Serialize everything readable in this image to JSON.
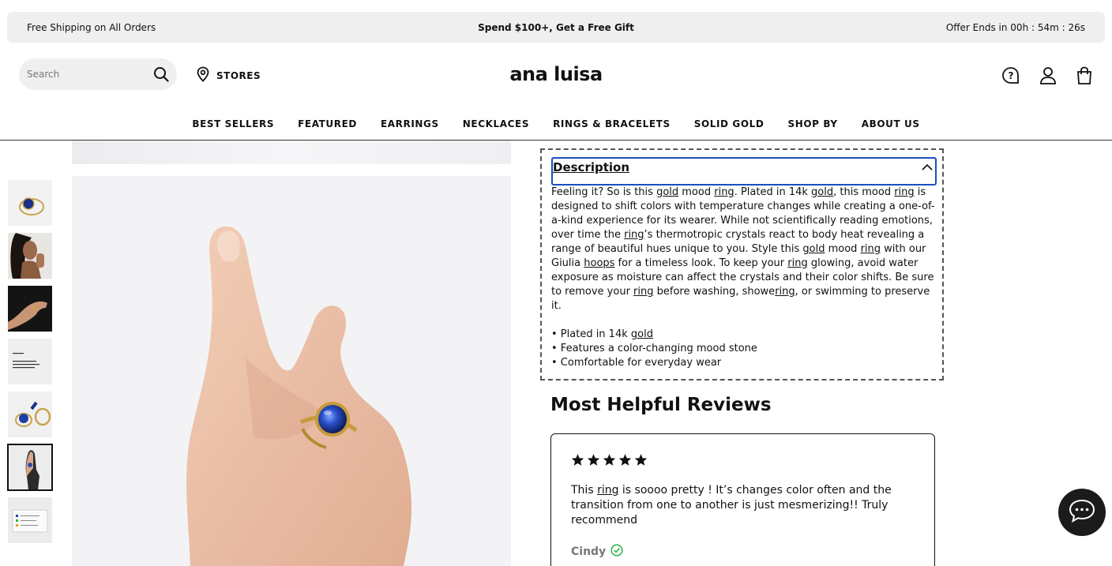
{
  "promo": {
    "left": "Free Shipping on All Orders",
    "center": "Spend $100+, Get a Free Gift",
    "right": "Offer Ends in 00h : 54m : 26s"
  },
  "header": {
    "search_placeholder": "Search",
    "stores_label": "STORES",
    "logo": "ana luisa",
    "icons": [
      "help-icon",
      "account-icon",
      "bag-icon"
    ]
  },
  "nav": {
    "items": [
      "BEST SELLERS",
      "FEATURED",
      "EARRINGS",
      "NECKLACES",
      "RINGS & BRACELETS",
      "SOLID GOLD",
      "SHOP BY",
      "ABOUT US"
    ]
  },
  "description": {
    "title": "Description",
    "paragraph": [
      {
        "t": "Feeling it? So is this "
      },
      {
        "u": "gold"
      },
      {
        "t": " mood "
      },
      {
        "u": "ring"
      },
      {
        "t": ". Plated in 14k "
      },
      {
        "u": "gold"
      },
      {
        "t": ", this mood "
      },
      {
        "u": "ring"
      },
      {
        "t": " is designed to shift colors with temperature changes while creating a one-of-a-kind experience for its wearer. While not scientifically reading emotions, over time the "
      },
      {
        "u": "ring"
      },
      {
        "t": "’s thermotropic crystals react to body heat revealing a range of beautiful hues unique to you. Style this "
      },
      {
        "u": "gold"
      },
      {
        "t": " mood "
      },
      {
        "u": "ring"
      },
      {
        "t": " with our Giulia "
      },
      {
        "u": "hoops"
      },
      {
        "t": " for a timeless look. To keep your "
      },
      {
        "u": "ring"
      },
      {
        "t": " glowing, avoid water exposure as moisture can affect the crystals and their color shifts. Be sure to remove your "
      },
      {
        "u": "ring"
      },
      {
        "t": " before washing, showe"
      },
      {
        "u": "ring"
      },
      {
        "t": ", or swimming to preserve it."
      }
    ],
    "bullets": [
      [
        {
          "t": "• Plated in 14k "
        },
        {
          "u": "gold"
        }
      ],
      [
        {
          "t": "• Features a color-changing mood stone"
        }
      ],
      [
        {
          "t": "• Comfortable for everyday wear"
        }
      ]
    ]
  },
  "reviews": {
    "title": "Most Helpful Reviews",
    "items": [
      {
        "stars": 5,
        "text": [
          {
            "t": "This "
          },
          {
            "u": "ring"
          },
          {
            "t": " is soooo pretty ! It’s changes color often and the transition from one to another is just mesmerizing!! Truly recommend"
          }
        ],
        "author": "Cindy"
      }
    ]
  },
  "gallery": {
    "thumb_count": 7,
    "active_thumb": 6
  },
  "colors": {
    "promo_bg": "#efefef",
    "focus_outline": "#1a4fbf",
    "verified": "#2db34a",
    "chat_bg": "#1b1b1b"
  }
}
